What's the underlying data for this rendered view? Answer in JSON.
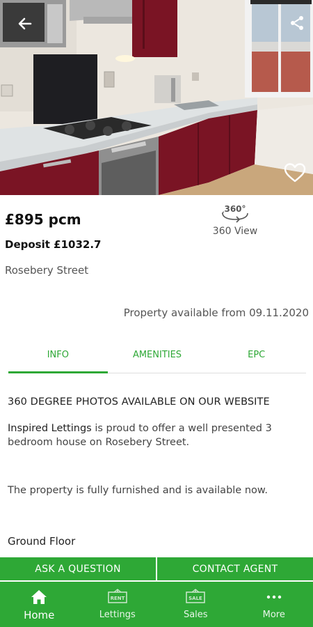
{
  "listing": {
    "price": "£895 pcm",
    "deposit": "Deposit £1032.7",
    "street": "Rosebery Street",
    "availability": "Property available from 09.11.2020",
    "view360_label": "360 View",
    "view360_badge": "360°"
  },
  "icons": {
    "back": "arrow-left-icon",
    "share": "share-icon",
    "favorite": "heart-outline-icon",
    "view360": "360-rotate-icon"
  },
  "tabs": [
    {
      "label": "INFO",
      "active": true
    },
    {
      "label": "AMENITIES",
      "active": false
    },
    {
      "label": "EPC",
      "active": false
    }
  ],
  "description": {
    "heading": "360 DEGREE PHOTOS AVAILABLE ON OUR WEBSITE",
    "agency_name": "Inspired Lettings",
    "intro_rest": " is proud to offer a well presented 3 bedroom house on Rosebery Street.",
    "furnished": "The property is fully furnished and is available now.",
    "section": "Ground Floor"
  },
  "actions": {
    "ask": "ASK A QUESTION",
    "contact": "CONTACT AGENT"
  },
  "nav": [
    {
      "label": "Home",
      "icon": "home-icon",
      "active": true
    },
    {
      "label": "Lettings",
      "icon": "rent-sign-icon",
      "badge": "RENT",
      "active": false
    },
    {
      "label": "Sales",
      "icon": "sale-sign-icon",
      "badge": "SALE",
      "active": false
    },
    {
      "label": "More",
      "icon": "more-dots-icon",
      "active": false
    }
  ],
  "colors": {
    "accent": "#2ea836",
    "cabinet": "#7a1424",
    "worktop": "#dfe3e4"
  }
}
